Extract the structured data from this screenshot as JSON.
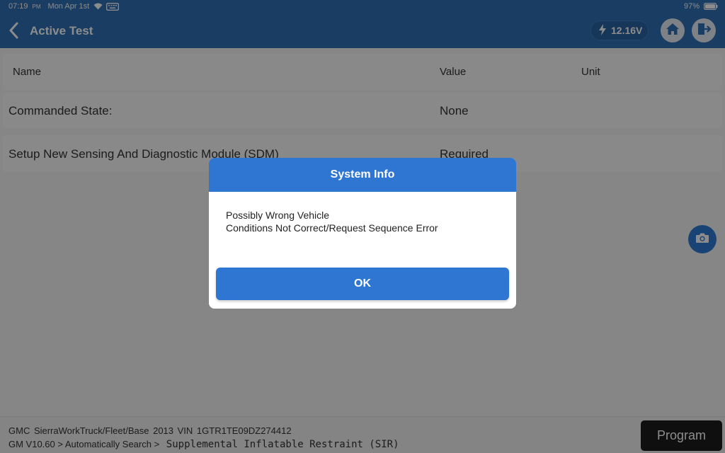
{
  "status_bar": {
    "time": "07:19",
    "ampm": "PM",
    "date": "Mon Apr 1st",
    "battery": "97%"
  },
  "header": {
    "title": "Active Test",
    "voltage": "12.16V"
  },
  "table": {
    "columns": [
      "Name",
      "Value",
      "Unit"
    ],
    "rows": [
      {
        "name": "Commanded State:",
        "value": "None",
        "unit": ""
      },
      {
        "name": "Setup New Sensing And Diagnostic Module (SDM)",
        "value": "Required",
        "unit": ""
      }
    ]
  },
  "footer": {
    "vehicle_info": "GMC  SierraWorkTruck/Fleet/Base  2013  VIN  1GTR1TE09DZ274412",
    "path": "GM V10.60 > Automatically Search >",
    "system": "Supplemental Inflatable Restraint (SIR)",
    "program_label": "Program"
  },
  "dialog": {
    "title": "System Info",
    "line1": "Possibly Wrong Vehicle",
    "line2": "Conditions Not Correct/Request Sequence Error",
    "ok_label": "OK"
  },
  "icons": {
    "back": "chevron-left-icon",
    "voltage": "lightning-icon",
    "home": "home-icon",
    "exit": "exit-icon",
    "camera": "camera-icon",
    "wifi": "wifi-icon",
    "keyboard": "keyboard-icon",
    "battery": "battery-icon"
  },
  "colors": {
    "header_blue": "#2f6fb5",
    "dialog_blue": "#2f76d2",
    "program_button": "#1d1d1d"
  }
}
